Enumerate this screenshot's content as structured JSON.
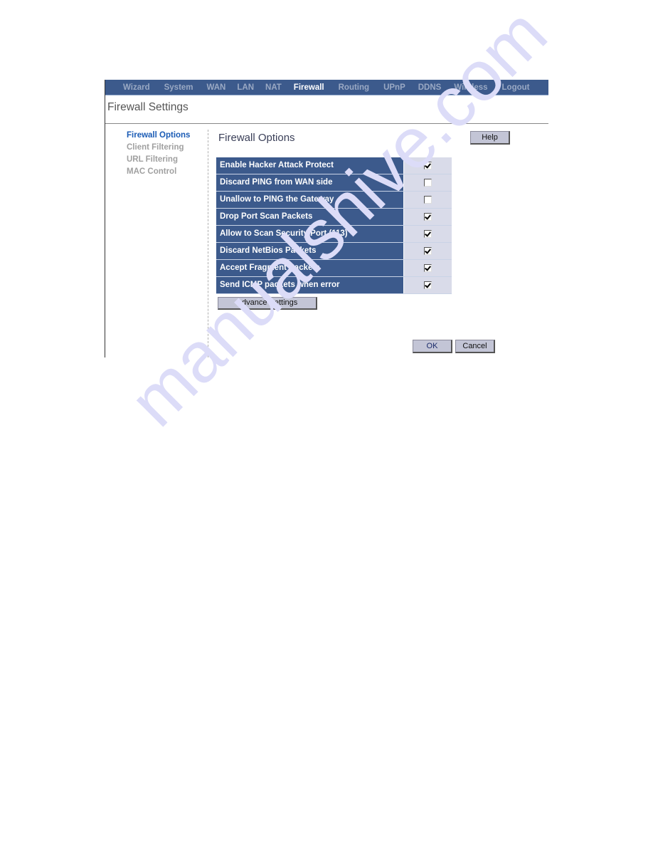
{
  "topnav": {
    "items": [
      {
        "label": "Wizard",
        "active": false
      },
      {
        "label": "System",
        "active": false
      },
      {
        "label": "WAN",
        "active": false
      },
      {
        "label": "LAN",
        "active": false
      },
      {
        "label": "NAT",
        "active": false
      },
      {
        "label": "Firewall",
        "active": true
      },
      {
        "label": "Routing",
        "active": false
      },
      {
        "label": "UPnP",
        "active": false
      },
      {
        "label": "DDNS",
        "active": false
      },
      {
        "label": "Wireless",
        "active": false
      },
      {
        "label": "Logout",
        "active": false
      }
    ]
  },
  "page": {
    "title": "Firewall Settings"
  },
  "sidebar": {
    "items": [
      {
        "label": "Firewall Options",
        "active": true
      },
      {
        "label": "Client Filtering",
        "active": false
      },
      {
        "label": "URL Filtering",
        "active": false
      },
      {
        "label": "MAC Control",
        "active": false
      }
    ]
  },
  "main": {
    "section_title": "Firewall Options",
    "help_label": "Help",
    "options": [
      {
        "label": "Enable Hacker Attack Protect",
        "checked": true
      },
      {
        "label": "Discard PING from WAN side",
        "checked": false
      },
      {
        "label": "Unallow to PING the Gateway",
        "checked": false
      },
      {
        "label": "Drop Port Scan Packets",
        "checked": true
      },
      {
        "label": "Allow to Scan Security Port (113)",
        "checked": true
      },
      {
        "label": "Discard NetBios Packets",
        "checked": true
      },
      {
        "label": "Accept Fragment Packets",
        "checked": true
      },
      {
        "label": "Send ICMP packets when error",
        "checked": true
      }
    ],
    "advance_label": "Advance Settings",
    "ok_label": "OK",
    "cancel_label": "Cancel"
  },
  "watermark": "manualshive.com",
  "colors": {
    "nav_bg": "#3c5a8c",
    "active_link": "#1a5bb5",
    "button_bg": "#c3c5d6",
    "checkbox_cell_bg": "#d9dbe9"
  }
}
